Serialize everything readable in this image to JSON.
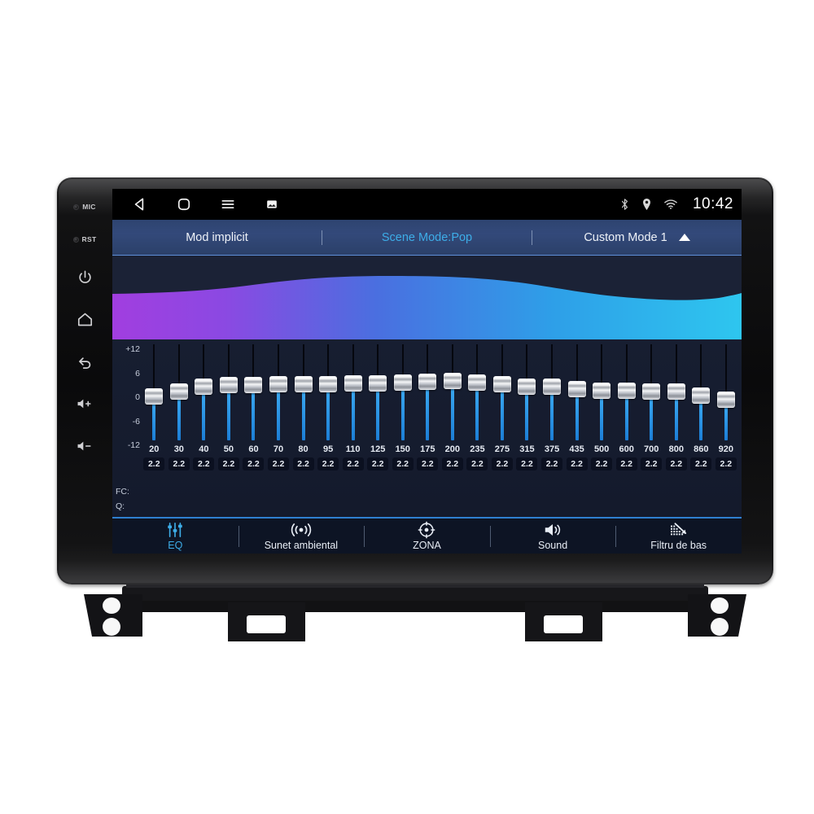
{
  "device": {
    "bezel_buttons": [
      {
        "name": "mic",
        "label": "MIC",
        "type": "pinhole"
      },
      {
        "name": "reset",
        "label": "RST",
        "type": "pinhole"
      },
      {
        "name": "power",
        "label": "",
        "type": "glyph"
      },
      {
        "name": "home",
        "label": "",
        "type": "glyph"
      },
      {
        "name": "back",
        "label": "",
        "type": "glyph"
      },
      {
        "name": "volume-up",
        "label": "",
        "type": "glyph"
      },
      {
        "name": "volume-down",
        "label": "",
        "type": "glyph"
      }
    ]
  },
  "statusbar": {
    "nav": [
      "back-icon",
      "home-icon",
      "menu-icon",
      "screenshot-icon"
    ],
    "icons": [
      "bluetooth-icon",
      "location-icon",
      "wifi-icon"
    ],
    "clock": "10:42"
  },
  "modebar": {
    "left_label": "Mod implicit",
    "center_label": "Scene Mode:Pop",
    "right_label": "Custom Mode 1",
    "expand_icon": "caret-up-icon",
    "active": "center",
    "active_color": "#3dade8"
  },
  "wave": {
    "gradient_start": "#a13ee0",
    "gradient_mid": "#4a6fe0",
    "gradient_end": "#2ec6ef",
    "background": "#1b2236"
  },
  "equalizer": {
    "scale_labels": [
      "+12",
      "6",
      "0",
      "-6",
      "-12"
    ],
    "scale_max": 12,
    "scale_min": -12,
    "fc_row_label": "FC:",
    "q_row_label": "Q:",
    "track_color": "#2b8fe0",
    "bands": [
      {
        "fc": "20",
        "q": "2.2",
        "gain": -1.0
      },
      {
        "fc": "30",
        "q": "2.2",
        "gain": 0.3
      },
      {
        "fc": "40",
        "q": "2.2",
        "gain": 1.4
      },
      {
        "fc": "50",
        "q": "2.2",
        "gain": 1.9
      },
      {
        "fc": "60",
        "q": "2.2",
        "gain": 1.8
      },
      {
        "fc": "70",
        "q": "2.2",
        "gain": 2.1
      },
      {
        "fc": "80",
        "q": "2.2",
        "gain": 2.0
      },
      {
        "fc": "95",
        "q": "2.2",
        "gain": 2.1
      },
      {
        "fc": "110",
        "q": "2.2",
        "gain": 2.2
      },
      {
        "fc": "125",
        "q": "2.2",
        "gain": 2.3
      },
      {
        "fc": "150",
        "q": "2.2",
        "gain": 2.4
      },
      {
        "fc": "175",
        "q": "2.2",
        "gain": 2.6
      },
      {
        "fc": "200",
        "q": "2.2",
        "gain": 2.8
      },
      {
        "fc": "235",
        "q": "2.2",
        "gain": 2.5
      },
      {
        "fc": "275",
        "q": "2.2",
        "gain": 2.1
      },
      {
        "fc": "315",
        "q": "2.2",
        "gain": 1.5
      },
      {
        "fc": "375",
        "q": "2.2",
        "gain": 1.4
      },
      {
        "fc": "435",
        "q": "2.2",
        "gain": 0.8
      },
      {
        "fc": "500",
        "q": "2.2",
        "gain": 0.4
      },
      {
        "fc": "600",
        "q": "2.2",
        "gain": 0.4
      },
      {
        "fc": "700",
        "q": "2.2",
        "gain": 0.3
      },
      {
        "fc": "800",
        "q": "2.2",
        "gain": 0.3
      },
      {
        "fc": "860",
        "q": "2.2",
        "gain": -0.8
      },
      {
        "fc": "920",
        "q": "2.2",
        "gain": -1.8
      }
    ]
  },
  "tabbar": {
    "active_index": 0,
    "active_color": "#3dade8",
    "tabs": [
      {
        "label": "EQ",
        "icon": "equalizer-icon"
      },
      {
        "label": "Sunet ambiental",
        "icon": "surround-sound-icon"
      },
      {
        "label": "ZONA",
        "icon": "zone-target-icon"
      },
      {
        "label": "Sound",
        "icon": "speaker-icon"
      },
      {
        "label": "Filtru de bas",
        "icon": "bass-filter-icon"
      }
    ]
  }
}
